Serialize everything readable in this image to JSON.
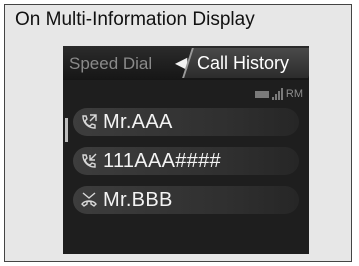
{
  "caption": "On Multi-Information Display",
  "tabs": {
    "inactive_label": "Speed Dial",
    "arrow_icon": "triangle-left-icon",
    "active_label": "Call History"
  },
  "status": {
    "battery_icon": "battery-icon",
    "signal_icon": "signal-strength-icon",
    "roaming_text": "RM"
  },
  "calls": [
    {
      "type_icon": "outgoing-call-icon",
      "label": "Mr.AAA"
    },
    {
      "type_icon": "incoming-call-icon",
      "label": "111AAA####"
    },
    {
      "type_icon": "missed-call-icon",
      "label": "Mr.BBB"
    }
  ],
  "colors": {
    "screen_background": "#1e1e1e",
    "row_highlight": "#3d3d3d",
    "text_primary": "#ffffff",
    "text_dim": "#8a8a8a",
    "caption_background": "#e7e7e7"
  }
}
